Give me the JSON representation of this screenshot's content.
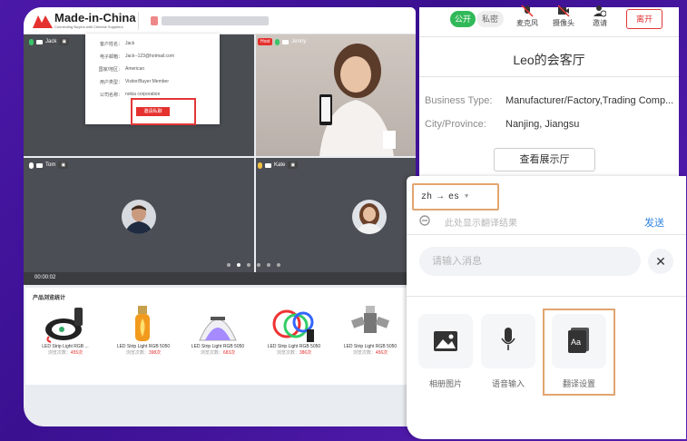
{
  "header": {
    "logo_text": "Made-in-China",
    "logo_sub": "Connecting Buyers with Chinese Suppliers"
  },
  "tiles": {
    "jack": {
      "name": "Jack"
    },
    "jenny": {
      "name": "Jenny",
      "host_badge": "Host"
    },
    "tom": {
      "name": "Tom"
    },
    "kate": {
      "name": "Kate"
    }
  },
  "popup": {
    "rows": [
      {
        "k": "客户姓名：",
        "v": "Jack"
      },
      {
        "k": "电子邮箱：",
        "v": "Jack--123@hotmail.com"
      },
      {
        "k": "国家/地区：",
        "v": "American"
      },
      {
        "k": "用户类型：",
        "v": "Visitor/Buyer Member"
      },
      {
        "k": "公司名称：",
        "v": "nokia corporation"
      }
    ],
    "contact_label": "邀请私聊"
  },
  "timer": "00:00:02",
  "products": {
    "title": "产品浏览统计",
    "views_prefix": "浏览次数：",
    "items": [
      {
        "name": "LED Strip Light RGB ...",
        "views": "455次"
      },
      {
        "name": "LED Strip Light RGB 5050",
        "views": "398次"
      },
      {
        "name": "LED Strip Light RGB 5050",
        "views": "683次"
      },
      {
        "name": "LED Strip Light RGB 5050",
        "views": "386次"
      },
      {
        "name": "LED Strip Light RGB 5050",
        "views": "456次"
      }
    ]
  },
  "room": {
    "public_label": "公开",
    "private_label": "私密",
    "mic_label": "麦克风",
    "camera_label": "摄像头",
    "invite_label": "邀请",
    "leave_label": "离开",
    "title": "Leo的会客厅",
    "business_type_key": "Business Type:",
    "business_type_val": "Manufacturer/Factory,Trading Comp...",
    "city_key": "City/Province:",
    "city_val": "Nanjing, Jiangsu",
    "showroom_label": "查看展示厅"
  },
  "translate": {
    "from": "zh",
    "arrow": "→",
    "to": "es",
    "hint": "此处显示翻译结果",
    "send_label": "发送",
    "input_placeholder": "请输入消息",
    "tools": [
      {
        "label": "相册图片",
        "icon": "image-icon"
      },
      {
        "label": "语音输入",
        "icon": "microphone-icon"
      },
      {
        "label": "翻译设置",
        "icon": "translate-settings-icon"
      }
    ]
  },
  "colors": {
    "accent_red": "#e5312e",
    "accent_green": "#31b959",
    "send_blue": "#2f84e0",
    "highlight_orange": "#e2a56f"
  }
}
